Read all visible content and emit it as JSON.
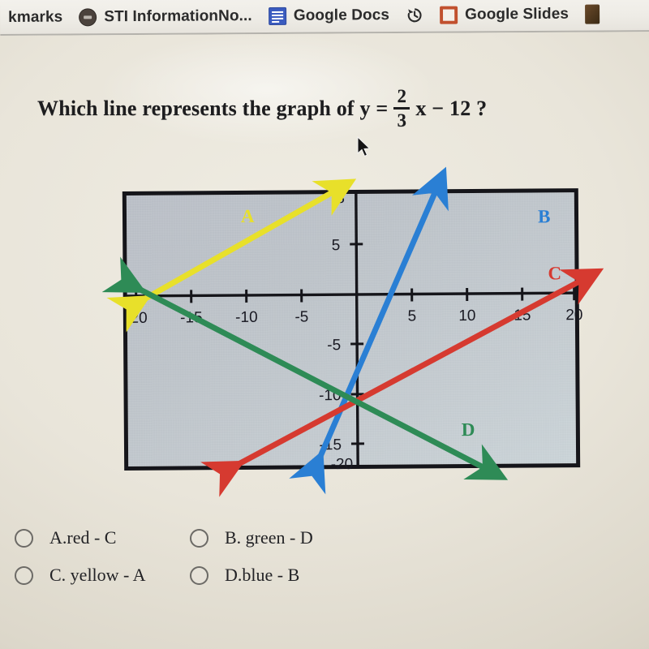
{
  "browser": {
    "bookmarks": [
      {
        "label": "kmarks",
        "icon": "none"
      },
      {
        "label": "STI InformationNo...",
        "icon": "sti-favicon"
      },
      {
        "label": "Google Docs",
        "icon": "google-docs-icon"
      },
      {
        "label": "Google Slides",
        "icon": "google-slides-icon",
        "lead_icon": "history-icon"
      }
    ]
  },
  "question": {
    "prefix": "Which line represents the graph of y =",
    "numerator": "2",
    "denominator": "3",
    "suffix": "x − 12 ?"
  },
  "chart_data": {
    "type": "line",
    "title": "",
    "xlabel": "",
    "ylabel": "",
    "xlim": [
      -20,
      20
    ],
    "ylim": [
      -20,
      8
    ],
    "grid": false,
    "legend": "inline-labels",
    "xticks": [
      -20,
      -15,
      -10,
      -5,
      5,
      10,
      15,
      20
    ],
    "xtick_labels": [
      "-20",
      "-15",
      "-10",
      "-5",
      "5",
      "10",
      "15",
      "20"
    ],
    "yticks": [
      8,
      5,
      -5,
      -10,
      -15,
      -20
    ],
    "ytick_labels": [
      "8",
      "5",
      "-5",
      "-10",
      "-15",
      "-20"
    ],
    "series": [
      {
        "name": "A",
        "label": "A",
        "color": "#e8e02a",
        "slope": 0.4,
        "intercept": 8,
        "points": [
          [
            -20,
            0
          ],
          [
            -5,
            6
          ]
        ],
        "x_intercept": -20,
        "arrows": "both"
      },
      {
        "name": "B",
        "label": "B",
        "color": "#2a7fd4",
        "slope": 2,
        "intercept": -12,
        "points": [
          [
            -4,
            -20
          ],
          [
            10,
            8
          ]
        ],
        "x_intercept": 6,
        "arrows": "both"
      },
      {
        "name": "C",
        "label": "C",
        "color": "#d63a30",
        "slope": 0.6667,
        "intercept": -12,
        "points": [
          [
            -12,
            -20
          ],
          [
            20,
            1.3
          ]
        ],
        "x_intercept": 18,
        "arrows": "both"
      },
      {
        "name": "D",
        "label": "D",
        "color": "#2e8b56",
        "slope": -0.6667,
        "intercept": -12,
        "points": [
          [
            -20,
            1.3
          ],
          [
            12,
            -20
          ]
        ],
        "x_intercept": -18,
        "arrows": "both"
      }
    ]
  },
  "options": [
    {
      "key": "A",
      "label": "A.red - C"
    },
    {
      "key": "B",
      "label": "B. green - D"
    },
    {
      "key": "C",
      "label": "C. yellow - A"
    },
    {
      "key": "D",
      "label": "D.blue - B"
    }
  ],
  "colors": {
    "yellow_line": "#e8e02a",
    "blue_line": "#2a7fd4",
    "red_line": "#d63a30",
    "green_line": "#2e8b56",
    "plot_background": "#bfc5cb",
    "plot_border": "#15151a",
    "page_background": "#e9e5da",
    "docs_blue": "#3a5bbf",
    "slides_orange": "#c1502e"
  }
}
